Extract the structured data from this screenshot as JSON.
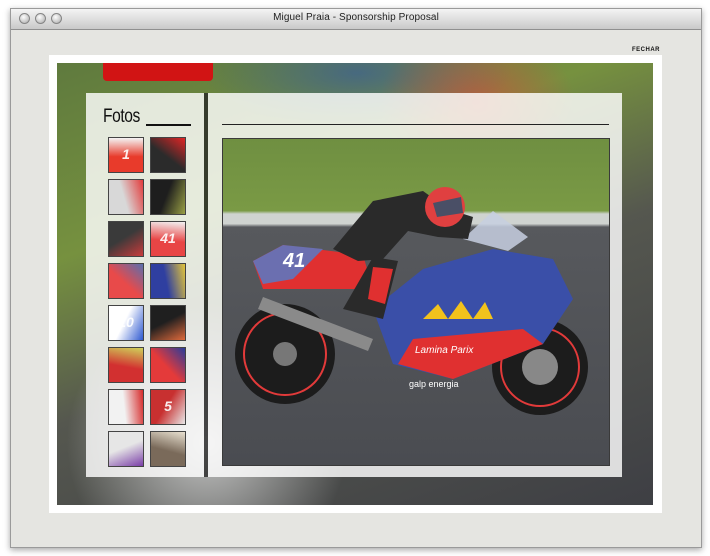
{
  "window": {
    "title": "Miguel Praia - Sponsorship Proposal",
    "close_link": "FECHAR"
  },
  "gallery": {
    "title": "Fotos",
    "thumbnails": [
      {
        "name": "thumb-1",
        "label": "1",
        "colors": [
          "#e83b2b",
          "#f4f4f4"
        ]
      },
      {
        "name": "thumb-2",
        "label": "",
        "colors": [
          "#2b2b2b",
          "#e02525"
        ]
      },
      {
        "name": "thumb-3",
        "label": "",
        "colors": [
          "#d8d8d8",
          "#e23b3b"
        ]
      },
      {
        "name": "thumb-4",
        "label": "",
        "colors": [
          "#1e1e1e",
          "#9aa045"
        ]
      },
      {
        "name": "thumb-5",
        "label": "",
        "colors": [
          "#3a3a3a",
          "#c93b3b"
        ]
      },
      {
        "name": "thumb-6",
        "label": "41",
        "colors": [
          "#e84545",
          "#f2f2f2"
        ]
      },
      {
        "name": "thumb-7",
        "label": "",
        "colors": [
          "#e84a4a",
          "#5a6fae"
        ]
      },
      {
        "name": "thumb-8",
        "label": "",
        "colors": [
          "#2f3fa0",
          "#e2c43b"
        ]
      },
      {
        "name": "thumb-9",
        "label": "10",
        "colors": [
          "#ffffff",
          "#2f5ad0"
        ]
      },
      {
        "name": "thumb-10",
        "label": "",
        "colors": [
          "#1f1f1f",
          "#e06a3b"
        ]
      },
      {
        "name": "thumb-11",
        "label": "",
        "colors": [
          "#d23030",
          "#cfd25a"
        ]
      },
      {
        "name": "thumb-12",
        "label": "",
        "colors": [
          "#e43a3a",
          "#2a3c9a"
        ]
      },
      {
        "name": "thumb-13",
        "label": "",
        "colors": [
          "#f2f2f2",
          "#d62a2a"
        ]
      },
      {
        "name": "thumb-14",
        "label": "5",
        "colors": [
          "#c83030",
          "#e8e8e8"
        ]
      },
      {
        "name": "thumb-15",
        "label": "",
        "colors": [
          "#e6e6e6",
          "#7a3ea8"
        ]
      },
      {
        "name": "thumb-16",
        "label": "",
        "colors": [
          "#7a6a5a",
          "#e8e0d0"
        ]
      }
    ]
  },
  "photo": {
    "sponsor_text": "Lamina Parix",
    "fairing_text": "galp energia",
    "race_number": "41"
  },
  "colors": {
    "accent_red": "#d11414",
    "bike_blue": "#3a4fa8",
    "bike_red": "#e03030"
  }
}
